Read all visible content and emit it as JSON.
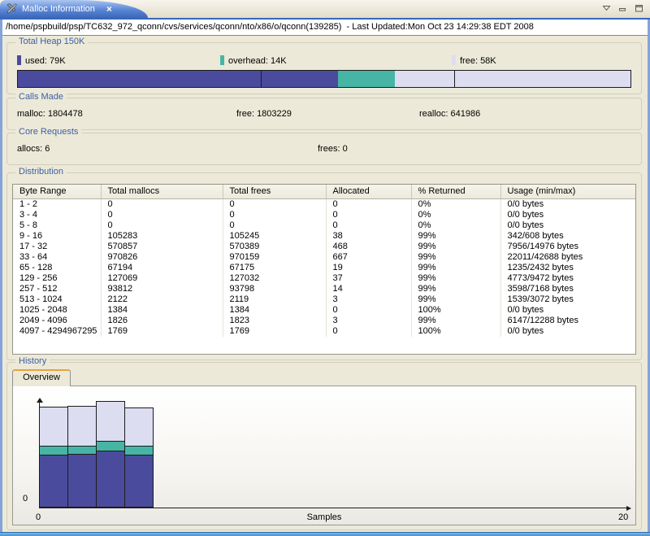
{
  "tab": {
    "title": "Malloc Information",
    "close_glyph": "×"
  },
  "path_bar": {
    "text": "/home/pspbuild/psp/TC632_972_qconn/cvs/services/qconn/nto/x86/o/qconn(139285)  - Last Updated:Mon Oct 23 14:29:38 EDT 2008"
  },
  "total_heap": {
    "title": "Total Heap 150K",
    "legend": [
      {
        "label": "used:  79K",
        "color": "#4b4b9d"
      },
      {
        "label": "overhead:  14K",
        "color": "#46b5a5"
      },
      {
        "label": "free:  58K",
        "color": "#dcddf1"
      }
    ],
    "bar_segments": [
      {
        "name": "used",
        "pct": 52.3,
        "color": "#4b4b9d"
      },
      {
        "name": "overhead",
        "pct": 9.3,
        "color": "#46b5a5"
      },
      {
        "name": "free",
        "pct": 38.4,
        "color": "#dcddf1"
      }
    ],
    "bar_dividers_pct": [
      39.7,
      71.2
    ]
  },
  "calls_made": {
    "title": "Calls Made",
    "items": [
      "malloc:  1804478",
      "free:  1803229",
      "realloc:  641986"
    ]
  },
  "core_requests": {
    "title": "Core Requests",
    "items": [
      "allocs:  6",
      "frees:  0"
    ]
  },
  "distribution": {
    "title": "Distribution",
    "columns": [
      "Byte Range",
      "Total mallocs",
      "Total frees",
      "Allocated",
      "% Returned",
      "Usage (min/max)"
    ],
    "rows": [
      [
        "1 - 2",
        "0",
        "0",
        "0",
        "0%",
        "0/0 bytes"
      ],
      [
        "3 - 4",
        "0",
        "0",
        "0",
        "0%",
        "0/0 bytes"
      ],
      [
        "5 - 8",
        "0",
        "0",
        "0",
        "0%",
        "0/0 bytes"
      ],
      [
        "9 - 16",
        "105283",
        "105245",
        "38",
        "99%",
        "342/608 bytes"
      ],
      [
        "17 - 32",
        "570857",
        "570389",
        "468",
        "99%",
        "7956/14976 bytes"
      ],
      [
        "33 - 64",
        "970826",
        "970159",
        "667",
        "99%",
        "22011/42688 bytes"
      ],
      [
        "65 - 128",
        "67194",
        "67175",
        "19",
        "99%",
        "1235/2432 bytes"
      ],
      [
        "129 - 256",
        "127069",
        "127032",
        "37",
        "99%",
        "4773/9472 bytes"
      ],
      [
        "257 - 512",
        "93812",
        "93798",
        "14",
        "99%",
        "3598/7168 bytes"
      ],
      [
        "513 - 1024",
        "2122",
        "2119",
        "3",
        "99%",
        "1539/3072 bytes"
      ],
      [
        "1025 - 2048",
        "1384",
        "1384",
        "0",
        "100%",
        "0/0 bytes"
      ],
      [
        "2049 - 4096",
        "1826",
        "1823",
        "3",
        "99%",
        "6147/12288 bytes"
      ],
      [
        "4097 - 4294967295",
        "1769",
        "1769",
        "0",
        "100%",
        "0/0 bytes"
      ]
    ]
  },
  "history": {
    "title": "History",
    "tab_label": "Overview"
  },
  "chart_data": {
    "type": "bar",
    "stacked": true,
    "x": [
      0,
      1,
      2,
      3
    ],
    "series": [
      {
        "name": "used",
        "color": "#4b4b9d",
        "values": [
          79,
          81,
          86,
          80
        ]
      },
      {
        "name": "overhead",
        "color": "#46b5a5",
        "values": [
          13,
          11,
          14,
          12
        ]
      },
      {
        "name": "free",
        "color": "#dcddf1",
        "values": [
          59,
          60,
          60,
          58
        ]
      }
    ],
    "xlabel": "Samples",
    "xlim": [
      0,
      20
    ],
    "ylim": [
      0,
      165
    ],
    "x_tick_labels": [
      "0",
      "20"
    ],
    "y_tick_labels": [
      "0"
    ],
    "units": "KB"
  }
}
